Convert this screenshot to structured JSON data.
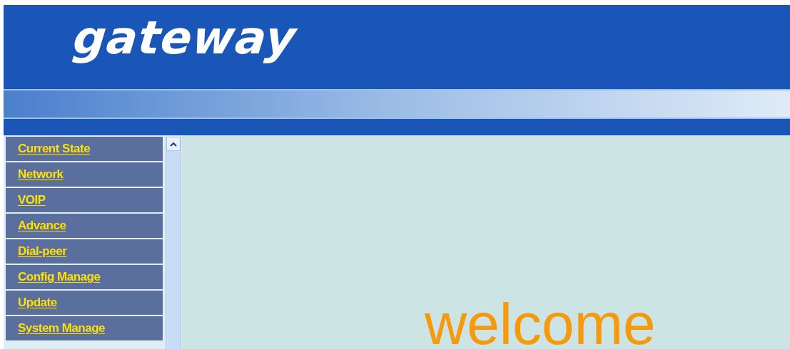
{
  "header": {
    "logo": "gateway"
  },
  "sidebar": {
    "items": [
      {
        "label": "Current State"
      },
      {
        "label": "Network"
      },
      {
        "label": "VOIP"
      },
      {
        "label": "Advance"
      },
      {
        "label": "Dial-peer"
      },
      {
        "label": "Config Manage"
      },
      {
        "label": "Update"
      },
      {
        "label": "System Manage"
      }
    ]
  },
  "content": {
    "welcome": "welcome"
  }
}
